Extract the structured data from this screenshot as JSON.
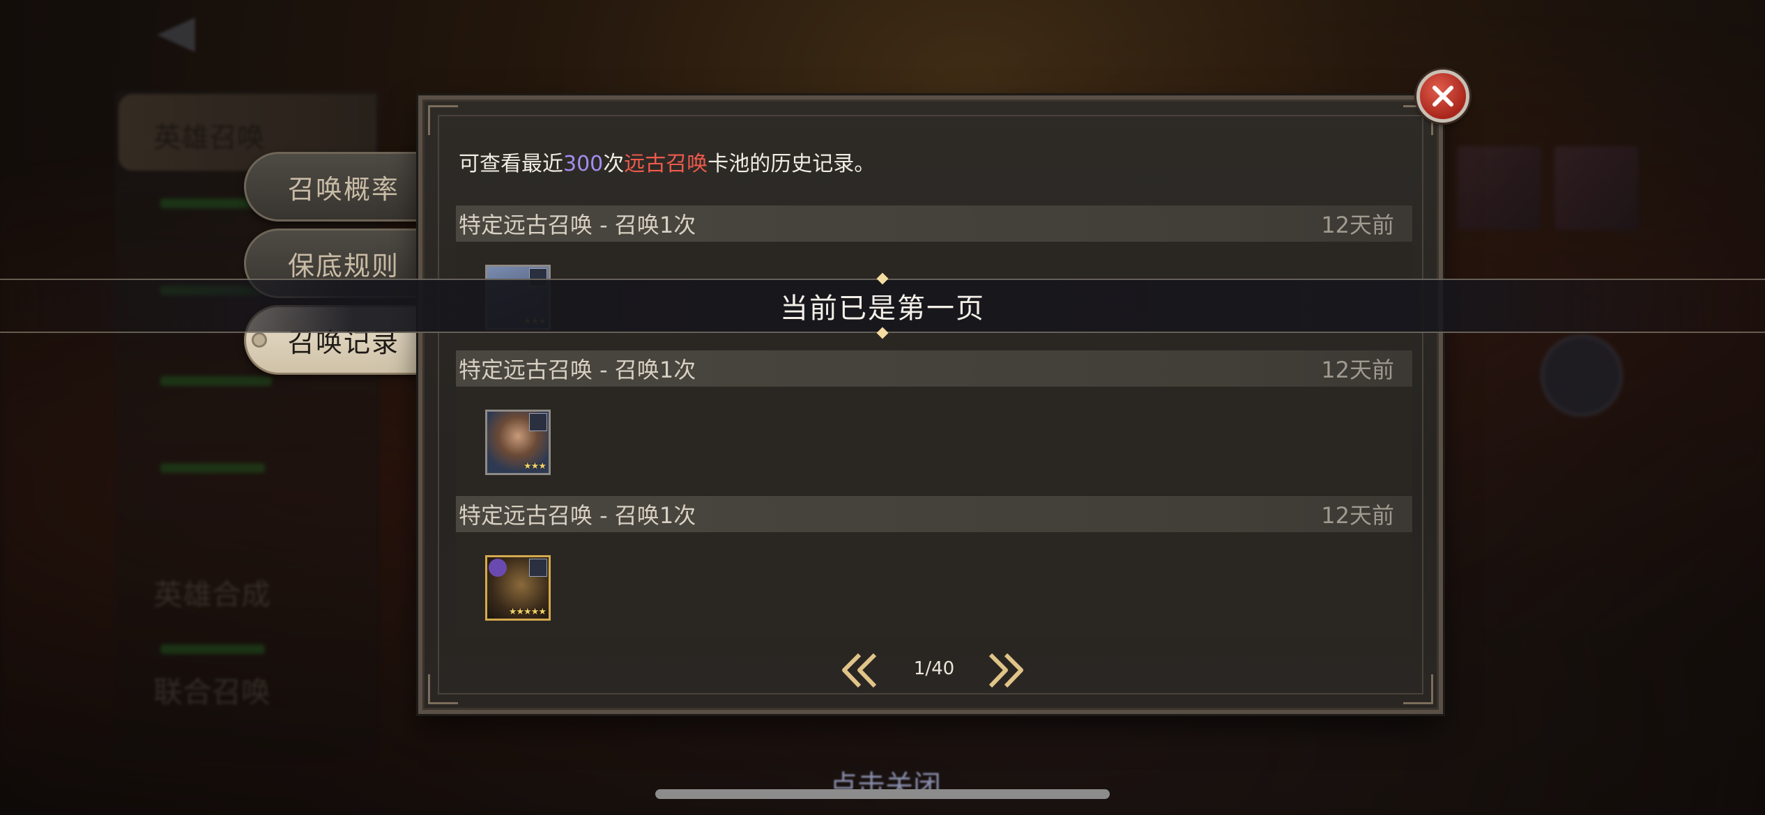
{
  "background_menu": {
    "header": "英雄召唤",
    "items": [
      "英雄合成",
      "联合召唤"
    ]
  },
  "tabs": [
    {
      "label": "召唤概率",
      "active": false
    },
    {
      "label": "保底规则",
      "active": false
    },
    {
      "label": "召唤记录",
      "active": true
    }
  ],
  "info": {
    "prefix": "可查看最近",
    "count": "300",
    "mid": "次",
    "pool": "远古召唤",
    "suffix": "卡池的历史记录。"
  },
  "records": [
    {
      "title": "特定远古召唤 - 召唤1次",
      "time": "12天前",
      "hero_stars": 3,
      "hero": "elf-hero-icon"
    },
    {
      "title": "特定远古召唤 - 召唤1次",
      "time": "12天前",
      "hero_stars": 3,
      "hero": "bearded-warrior-icon"
    },
    {
      "title": "特定远古召唤 - 召唤1次",
      "time": "12天前",
      "hero_stars": 5,
      "hero": "hooded-mage-icon"
    }
  ],
  "toast": "当前已是第一页",
  "pagination": {
    "current": "1/40"
  },
  "tap_close": "点击关闭",
  "colors": {
    "count": "#a58cf0",
    "pool": "#ef5a4c",
    "close": "#c3362a"
  }
}
